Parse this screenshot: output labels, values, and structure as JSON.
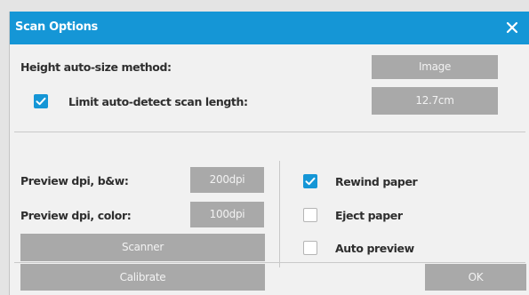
{
  "window": {
    "title": "Scan Options",
    "close_icon": "close-icon"
  },
  "colors": {
    "accent": "#1596d6",
    "button": "#a9a9a9",
    "background": "#f1f1f1"
  },
  "height_autosize": {
    "label": "Height auto-size method:",
    "value": "Image"
  },
  "limit_autodetect": {
    "label": "Limit auto-detect scan length:",
    "checked": true,
    "value": "12.7cm"
  },
  "preview_bw": {
    "label": "Preview dpi, b&w:",
    "value": "200dpi"
  },
  "preview_color": {
    "label": "Preview dpi, color:",
    "value": "100dpi"
  },
  "buttons": {
    "scanner": "Scanner",
    "calibrate": "Calibrate",
    "ok": "OK"
  },
  "options": {
    "rewind_paper": {
      "label": "Rewind paper",
      "checked": true
    },
    "eject_paper": {
      "label": "Eject paper",
      "checked": false
    },
    "auto_preview": {
      "label": "Auto preview",
      "checked": false
    }
  }
}
